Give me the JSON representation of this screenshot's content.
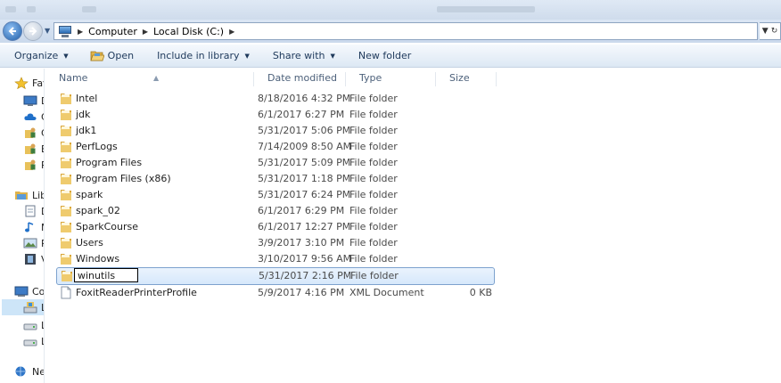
{
  "address": {
    "crumbs": [
      "Computer",
      "Local Disk (C:)"
    ]
  },
  "toolbar": {
    "organize": "Organize",
    "open": "Open",
    "include_in_library": "Include in library",
    "share_with": "Share with",
    "new_folder": "New folder"
  },
  "nav": {
    "favorites": "Fav",
    "fav_items": [
      "D",
      "C",
      "C",
      "B",
      "P"
    ],
    "libraries": "Lib",
    "lib_items": [
      "D",
      "M",
      "P",
      "V"
    ],
    "computer": "Co",
    "computer_items": [
      "L",
      "L",
      "L"
    ],
    "network": "Ne"
  },
  "columns": {
    "name": "Name",
    "date_modified": "Date modified",
    "type": "Type",
    "size": "Size"
  },
  "files": [
    {
      "name": "Intel",
      "date": "8/18/2016 4:32 PM",
      "type": "File folder",
      "size": ""
    },
    {
      "name": "jdk",
      "date": "6/1/2017 6:27 PM",
      "type": "File folder",
      "size": ""
    },
    {
      "name": "jdk1",
      "date": "5/31/2017 5:06 PM",
      "type": "File folder",
      "size": ""
    },
    {
      "name": "PerfLogs",
      "date": "7/14/2009 8:50 AM",
      "type": "File folder",
      "size": ""
    },
    {
      "name": "Program Files",
      "date": "5/31/2017 5:09 PM",
      "type": "File folder",
      "size": ""
    },
    {
      "name": "Program Files (x86)",
      "date": "5/31/2017 1:18 PM",
      "type": "File folder",
      "size": ""
    },
    {
      "name": "spark",
      "date": "5/31/2017 6:24 PM",
      "type": "File folder",
      "size": ""
    },
    {
      "name": "spark_02",
      "date": "6/1/2017 6:29 PM",
      "type": "File folder",
      "size": ""
    },
    {
      "name": "SparkCourse",
      "date": "6/1/2017 12:27 PM",
      "type": "File folder",
      "size": ""
    },
    {
      "name": "Users",
      "date": "3/9/2017 3:10 PM",
      "type": "File folder",
      "size": ""
    },
    {
      "name": "Windows",
      "date": "3/10/2017 9:56 AM",
      "type": "File folder",
      "size": ""
    },
    {
      "name": "winutils",
      "date": "5/31/2017 2:16 PM",
      "type": "File folder",
      "size": ""
    },
    {
      "name": "FoxitReaderPrinterProfile",
      "date": "5/9/2017 4:16 PM",
      "type": "XML Document",
      "size": "0 KB"
    }
  ],
  "rename_value": "winutils",
  "colors": {
    "selection_bg": "#d6e8fb",
    "selection_border": "#7da2ce",
    "toolbar_text": "#1e395b",
    "folder_yellow": "#e8c15a"
  }
}
